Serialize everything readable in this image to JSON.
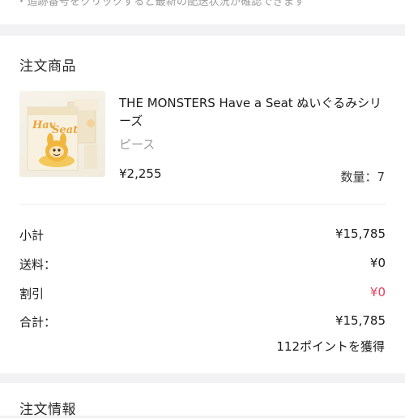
{
  "top_note": "・追跡番号をクリックすると最新の配送状況が確認できます",
  "order_items": {
    "title": "注文商品",
    "product": {
      "image_logo_text": "Have a Seat",
      "name": "THE MONSTERS Have a Seat ぬいぐるみシリーズ",
      "variant": "ピース",
      "price": "¥2,255",
      "quantity": "数量：7"
    }
  },
  "summary": {
    "subtotal": {
      "label": "小計",
      "value": "¥15,785"
    },
    "shipping": {
      "label": "送料：",
      "value": "¥0"
    },
    "discount": {
      "label": "割引",
      "value": "¥0"
    },
    "total": {
      "label": "合計：",
      "value": "¥15,785"
    },
    "points": "112ポイントを獲得"
  },
  "next_section": {
    "title": "注文情報"
  },
  "colors": {
    "discount": "#e2415c",
    "muted_text": "#9b9b9b",
    "page_background": "#f2f2f4"
  }
}
